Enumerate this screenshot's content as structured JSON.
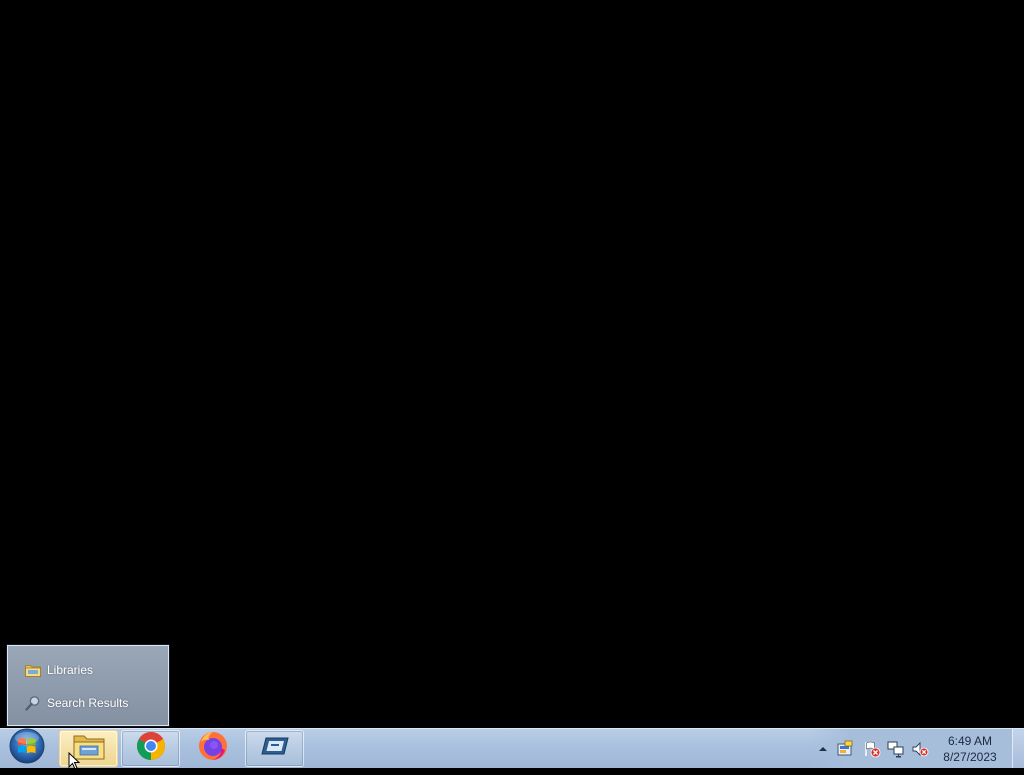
{
  "jumplist": {
    "items": [
      {
        "label": "Libraries",
        "icon": "libraries-folder-icon"
      },
      {
        "label": "Search Results",
        "icon": "search-icon"
      }
    ]
  },
  "taskbar": {
    "start": {
      "icon": "windows-start-orb-icon"
    },
    "buttons": [
      {
        "name": "Windows Explorer",
        "icon": "folder-explorer-icon",
        "state": "active"
      },
      {
        "name": "Google Chrome",
        "icon": "chrome-icon",
        "state": "pinned"
      },
      {
        "name": "Firefox",
        "icon": "firefox-icon",
        "state": "normal"
      },
      {
        "name": "VMware",
        "icon": "vmware-icon",
        "state": "pinned"
      }
    ]
  },
  "tray": {
    "icons": [
      "show-hidden-icons-arrow",
      "tray-app-icon",
      "action-center-flag-icon",
      "network-icon",
      "volume-muted-icon"
    ],
    "time": "6:49 AM",
    "date": "8/27/2023"
  },
  "colors": {
    "desktop": "#000000",
    "taskbar": "#a9c1de",
    "jumplist": "#8f9cad"
  }
}
